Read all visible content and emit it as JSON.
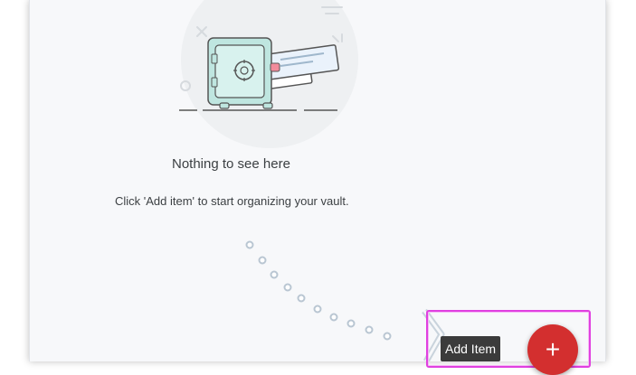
{
  "empty_state": {
    "title": "Nothing to see here",
    "subtitle": "Click 'Add item' to start organizing your vault."
  },
  "add_item": {
    "tooltip": "Add Item",
    "fab_icon": "plus-icon",
    "fab_glyph": "+",
    "fab_color": "#d32f2f",
    "highlight_color": "#e040e0"
  },
  "illustration": {
    "icon": "vault-safe-icon"
  }
}
